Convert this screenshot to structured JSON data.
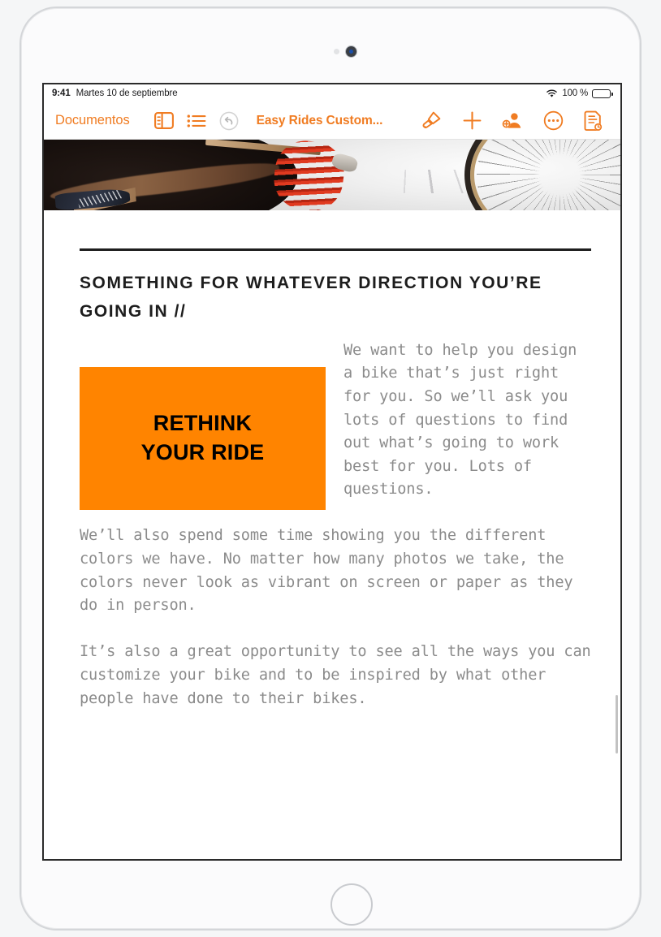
{
  "status_bar": {
    "time": "9:41",
    "date": "Martes 10 de septiembre",
    "wifi_icon": "wifi-icon",
    "battery_percent": "100 %",
    "battery_icon": "battery-full-icon"
  },
  "toolbar": {
    "back_label": "Documentos",
    "sidebar_icon": "sidebar-panel-icon",
    "list_icon": "bulleted-list-icon",
    "undo_icon": "undo-arrow-icon",
    "undo_enabled": false,
    "document_title": "Easy Rides Custom...",
    "format_icon": "paintbrush-format-icon",
    "insert_icon": "plus-insert-icon",
    "collaborate_icon": "add-person-icon",
    "more_icon": "ellipsis-more-icon",
    "document_info_icon": "document-clock-icon",
    "accent_color": "#f07c22",
    "disabled_color": "#c9c9c9"
  },
  "document": {
    "hero_image": "bicycle-pump-wheel-photo",
    "rule": "horizontal-rule",
    "headline": "SOMETHING FOR WHATEVER DIRECTION YOU’RE GOING IN //",
    "callout": {
      "line1": "RETHINK",
      "line2": "YOUR RIDE",
      "background_color": "#ff8400",
      "text_color": "#000000"
    },
    "paragraphs": [
      "We want to help you design a bike that’s just right for you. So we’ll ask you lots of questions to find out what’s going to work best for you. Lots of questions.",
      "We’ll also spend some time showing you the different colors we have. No matter how many photos we take, the colors never look as vibrant on screen or paper as they do in person.",
      "It’s also a great opportunity to see all the ways you can customize your bike and to be inspired by what other people have done to their bikes."
    ],
    "body_text_color": "#8b8b8b"
  },
  "device": {
    "front_camera": "front-camera",
    "ambient_sensor": "ambient-light-sensor",
    "home_button": "home-button"
  }
}
